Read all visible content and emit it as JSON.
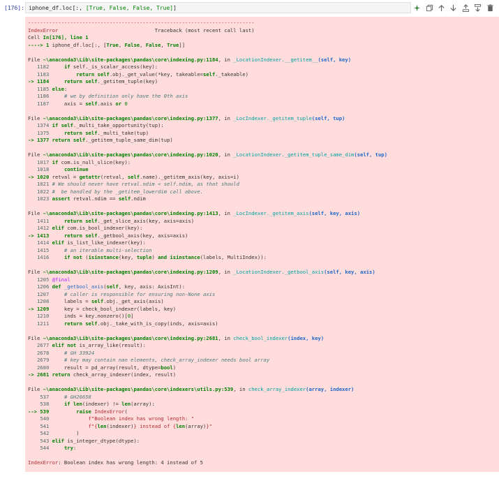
{
  "cell": {
    "prompt": "[176]:",
    "code_prefix": "iphone_df.loc[:, ",
    "code_args": "[True, False, False, True]",
    "code_suffix": "]"
  },
  "toolbar": {
    "icons": [
      "sparkle-icon",
      "copy-icon",
      "move-up-icon",
      "move-down-icon",
      "insert-above-icon",
      "insert-below-icon",
      "delete-icon"
    ]
  },
  "traceback": {
    "lines": [
      "<span class=\"err\">---------------------------------------------------------------------------</span>",
      "<span class=\"err\">IndexError</span>                                Traceback (most recent call last)",
      "Cell <span class=\"grn\">In[176], line 1</span>",
      "<span class=\"grn\">----&gt; 1</span> iphone_df.loc[:, [<span class=\"kw\">True</span>, <span class=\"kw\">False</span>, <span class=\"kw\">False</span>, <span class=\"kw\">True</span>]]",
      "",
      "File <span class=\"grn\">~\\anaconda3\\Lib\\site-packages\\pandas\\core\\indexing.py:1184</span>, in <span class=\"cyan\">_LocationIndexer.__getitem__</span><span class=\"bbold\">(self, key)</span>",
      "   <span class=\"ln\">1182</span>     <span class=\"kw\">if</span> self._is_scalar_access(key):",
      "   <span class=\"ln\">1183</span>         <span class=\"kw\">return</span> <span class=\"kw\">self</span>.obj._get_value(*key, takeable=<span class=\"kw\">self</span>._takeable)",
      "<span class=\"arrow\">-&gt; 1184</span>     <span class=\"kw\">return</span> <span class=\"kw\">self</span>._getitem_tuple(key)",
      "   <span class=\"ln\">1185</span> <span class=\"kw\">else</span>:",
      "   <span class=\"ln\">1186</span>     <span class=\"com\"># we by definition only have the 0th axis</span>",
      "   <span class=\"ln\">1187</span>     axis = <span class=\"kw\">self</span>.axis <span class=\"kw\">or</span> <span class=\"num\">0</span>",
      "",
      "File <span class=\"grn\">~\\anaconda3\\Lib\\site-packages\\pandas\\core\\indexing.py:1377</span>, in <span class=\"cyan\">_LocIndexer._getitem_tuple</span><span class=\"bbold\">(self, tup)</span>",
      "   <span class=\"ln\">1374</span> <span class=\"kw\">if</span> <span class=\"kw\">self</span>._multi_take_opportunity(tup):",
      "   <span class=\"ln\">1375</span>     <span class=\"kw\">return</span> <span class=\"kw\">self</span>._multi_take(tup)",
      "<span class=\"arrow\">-&gt; 1377</span> <span class=\"kw\">return</span> <span class=\"kw\">self</span>._getitem_tuple_same_dim(tup)",
      "",
      "File <span class=\"grn\">~\\anaconda3\\Lib\\site-packages\\pandas\\core\\indexing.py:1020</span>, in <span class=\"cyan\">_LocationIndexer._getitem_tuple_same_dim</span><span class=\"bbold\">(self, tup)</span>",
      "   <span class=\"ln\">1017</span> <span class=\"kw\">if</span> com.is_null_slice(key):",
      "   <span class=\"ln\">1018</span>     <span class=\"kw\">continue</span>",
      "<span class=\"arrow\">-&gt; 1020</span> retval = <span class=\"kw\">getattr</span>(retval, <span class=\"kw\">self</span>.name)._getitem_axis(key, axis=i)",
      "   <span class=\"ln\">1021</span> <span class=\"com\"># We should never have retval.ndim &lt; self.ndim, as that should</span>",
      "   <span class=\"ln\">1022</span> <span class=\"com\">#  be handled by the _getitem_lowerdim call above.</span>",
      "   <span class=\"ln\">1023</span> <span class=\"kw\">assert</span> retval.ndim == <span class=\"kw\">self</span>.ndim",
      "",
      "File <span class=\"grn\">~\\anaconda3\\Lib\\site-packages\\pandas\\core\\indexing.py:1413</span>, in <span class=\"cyan\">_LocIndexer._getitem_axis</span><span class=\"bbold\">(self, key, axis)</span>",
      "   <span class=\"ln\">1411</span>     <span class=\"kw\">return</span> <span class=\"kw\">self</span>._get_slice_axis(key, axis=axis)",
      "   <span class=\"ln\">1412</span> <span class=\"kw\">elif</span> com.is_bool_indexer(key):",
      "<span class=\"arrow\">-&gt; 1413</span>     <span class=\"kw\">return</span> <span class=\"kw\">self</span>._getbool_axis(key, axis=axis)",
      "   <span class=\"ln\">1414</span> <span class=\"kw\">elif</span> is_list_like_indexer(key):",
      "   <span class=\"ln\">1415</span>     <span class=\"com\"># an iterable multi-selection</span>",
      "   <span class=\"ln\">1416</span>     <span class=\"kw\">if</span> <span class=\"kw\">not</span> (<span class=\"kw\">isinstance</span>(key, <span class=\"kw\">tuple</span>) <span class=\"kw\">and</span> <span class=\"kw\">isinstance</span>(labels, MultiIndex)):",
      "",
      "File <span class=\"grn\">~\\anaconda3\\Lib\\site-packages\\pandas\\core\\indexing.py:1209</span>, in <span class=\"cyan\">_LocationIndexer._getbool_axis</span><span class=\"bbold\">(self, key, axis)</span>",
      "   <span class=\"ln\">1205</span> <span class=\"dec\">@final</span>",
      "   <span class=\"ln\">1206</span> <span class=\"kw\">def</span> <span class=\"blu\">_getbool_axis</span>(<span class=\"kw\">self</span>, key, axis: AxisInt):",
      "   <span class=\"ln\">1207</span>     <span class=\"com\"># caller is responsible for ensuring non-None axis</span>",
      "   <span class=\"ln\">1208</span>     labels = <span class=\"kw\">self</span>.obj._get_axis(axis)",
      "<span class=\"arrow\">-&gt; 1209</span>     key = check_bool_indexer(labels, key)",
      "   <span class=\"ln\">1210</span>     inds = key.nonzero()[<span class=\"num\">0</span>]",
      "   <span class=\"ln\">1211</span>     <span class=\"kw\">return</span> <span class=\"kw\">self</span>.obj._take_with_is_copy(inds, axis=axis)",
      "",
      "File <span class=\"grn\">~\\anaconda3\\Lib\\site-packages\\pandas\\core\\indexing.py:2681</span>, in <span class=\"cyan\">check_bool_indexer</span><span class=\"bbold\">(index, key)</span>",
      "   <span class=\"ln\">2677</span> <span class=\"kw\">elif</span> <span class=\"kw\">not</span> is_array_like(result):",
      "   <span class=\"ln\">2678</span>     <span class=\"com\"># GH 33924</span>",
      "   <span class=\"ln\">2679</span>     <span class=\"com\"># key may contain nan elements, check_array_indexer needs bool array</span>",
      "   <span class=\"ln\">2680</span>     result = pd_array(result, dtype=<span class=\"kw\">bool</span>)",
      "<span class=\"arrow\">-&gt; 2681</span> <span class=\"kw\">return</span> check_array_indexer(index, result)",
      "",
      "File <span class=\"grn\">~\\anaconda3\\Lib\\site-packages\\pandas\\core\\indexers\\utils.py:539</span>, in <span class=\"cyan\">check_array_indexer</span><span class=\"bbold\">(array, indexer)</span>",
      "    <span class=\"ln\">537</span>     <span class=\"com\"># GH26658</span>",
      "    <span class=\"ln\">538</span>     <span class=\"kw\">if</span> <span class=\"kw\">len</span>(indexer) != <span class=\"kw\">len</span>(array):",
      "<span class=\"arrow\">--&gt; 539</span>         <span class=\"kw\">raise</span> <span class=\"err\">IndexError</span>(",
      "    <span class=\"ln\">540</span>             <span class=\"str\">f\"Boolean index has wrong length: \"</span>",
      "    <span class=\"ln\">541</span>             <span class=\"str\">f\"{</span><span class=\"kw\">len</span>(indexer)<span class=\"str\">} instead of {</span><span class=\"kw\">len</span>(array)<span class=\"str\">}\"</span>",
      "    <span class=\"ln\">542</span>         )",
      "    <span class=\"ln\">543</span> <span class=\"kw\">elif</span> is_integer_dtype(dtype):",
      "    <span class=\"ln\">544</span>     <span class=\"kw\">try</span>:",
      "",
      "<span class=\"err\">IndexError</span>: Boolean index has wrong length: 4 instead of 5"
    ]
  }
}
